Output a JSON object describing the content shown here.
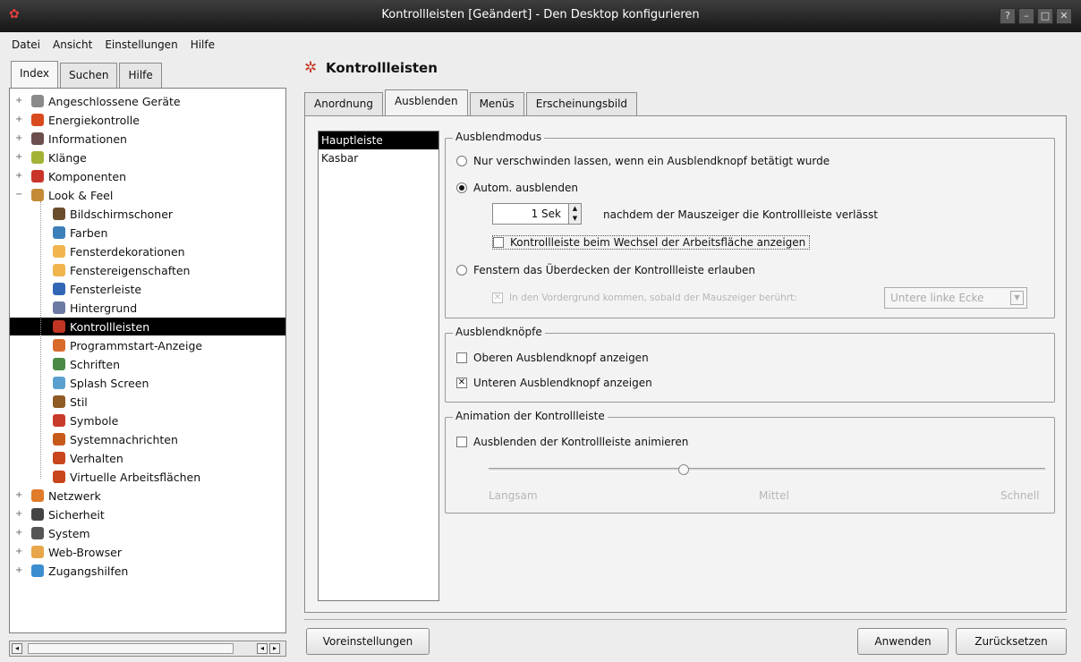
{
  "window": {
    "title": "Kontrollleisten [Geändert] - Den Desktop konfigurieren",
    "controls": [
      "?",
      "–",
      "□",
      "✕"
    ]
  },
  "menubar": [
    "Datei",
    "Ansicht",
    "Einstellungen",
    "Hilfe"
  ],
  "left_tabs": [
    "Index",
    "Suchen",
    "Hilfe"
  ],
  "tree": [
    {
      "label": "Angeschlossene Geräte",
      "icon": "devices-icon",
      "color": "#8a8a8a",
      "level": 0,
      "exp": "+"
    },
    {
      "label": "Energiekontrolle",
      "icon": "energy-icon",
      "color": "#d84b1e",
      "level": 0,
      "exp": "+"
    },
    {
      "label": "Informationen",
      "icon": "info-icon",
      "color": "#6c4e4e",
      "level": 0,
      "exp": "+"
    },
    {
      "label": "Klänge",
      "icon": "sound-icon",
      "color": "#a4b235",
      "level": 0,
      "exp": "+"
    },
    {
      "label": "Komponenten",
      "icon": "components-icon",
      "color": "#c93428",
      "level": 0,
      "exp": "+"
    },
    {
      "label": "Look & Feel",
      "icon": "look-feel-icon",
      "color": "#c58a36",
      "level": 0,
      "exp": "−"
    },
    {
      "label": "Bildschirmschoner",
      "icon": "screensaver-icon",
      "color": "#6a4d2c",
      "level": 1
    },
    {
      "label": "Farben",
      "icon": "colors-icon",
      "color": "#3d7fb8",
      "level": 1
    },
    {
      "label": "Fensterdekorationen",
      "icon": "window-deco-icon",
      "color": "#f0b54d",
      "level": 1
    },
    {
      "label": "Fenstereigenschaften",
      "icon": "window-props-icon",
      "color": "#f0b54d",
      "level": 1
    },
    {
      "label": "Fensterleiste",
      "icon": "taskbar-icon",
      "color": "#3166b5",
      "level": 1
    },
    {
      "label": "Hintergrund",
      "icon": "background-icon",
      "color": "#6b7aa3",
      "level": 1
    },
    {
      "label": "Kontrollleisten",
      "icon": "panels-icon",
      "color": "#c23524",
      "level": 1,
      "selected": true
    },
    {
      "label": "Programmstart-Anzeige",
      "icon": "launch-feedback-icon",
      "color": "#d86b2a",
      "level": 1
    },
    {
      "label": "Schriften",
      "icon": "fonts-icon",
      "color": "#4a8a46",
      "level": 1
    },
    {
      "label": "Splash Screen",
      "icon": "splash-icon",
      "color": "#5aa0cf",
      "level": 1
    },
    {
      "label": "Stil",
      "icon": "style-icon",
      "color": "#8f5a24",
      "level": 1
    },
    {
      "label": "Symbole",
      "icon": "symbols-icon",
      "color": "#c83a2a",
      "level": 1
    },
    {
      "label": "Systemnachrichten",
      "icon": "notifications-icon",
      "color": "#c65a1b",
      "level": 1
    },
    {
      "label": "Verhalten",
      "icon": "behavior-icon",
      "color": "#c9451d",
      "level": 1
    },
    {
      "label": "Virtuelle Arbeitsflächen",
      "icon": "desktops-icon",
      "color": "#c9451d",
      "level": 1
    },
    {
      "label": "Netzwerk",
      "icon": "network-icon",
      "color": "#e07b2a",
      "level": 0,
      "exp": "+"
    },
    {
      "label": "Sicherheit",
      "icon": "security-icon",
      "color": "#444444",
      "level": 0,
      "exp": "+"
    },
    {
      "label": "System",
      "icon": "system-icon",
      "color": "#555555",
      "level": 0,
      "exp": "+"
    },
    {
      "label": "Web-Browser",
      "icon": "web-browser-icon",
      "color": "#e8a64a",
      "level": 0,
      "exp": "+"
    },
    {
      "label": "Zugangshilfen",
      "icon": "accessibility-icon",
      "color": "#3b8ed0",
      "level": 0,
      "exp": "+"
    }
  ],
  "page_title": "Kontrollleisten",
  "tabs": [
    "Anordnung",
    "Ausblenden",
    "Menüs",
    "Erscheinungsbild"
  ],
  "panels_list": [
    "Hauptleiste",
    "Kasbar"
  ],
  "hide_mode": {
    "title": "Ausblendmodus",
    "opt1": "Nur verschwinden lassen, wenn ein Ausblendknopf betätigt wurde",
    "opt2": "Autom. ausblenden",
    "delay_value": "1 Sek",
    "delay_text": "nachdem der Mauszeiger die Kontrollleiste verlässt",
    "show_on_switch": "Kontrollleiste beim Wechsel der Arbeitsfläche anzeigen",
    "opt3": "Fenstern das Überdecken der Kontrollleiste erlauben",
    "raise_text": "In den Vordergrund kommen, sobald der Mauszeiger berührt:",
    "corner": "Untere linke Ecke"
  },
  "hide_buttons": {
    "title": "Ausblendknöpfe",
    "top": "Oberen Ausblendknopf anzeigen",
    "bottom": "Unteren Ausblendknopf anzeigen"
  },
  "animation": {
    "title": "Animation der Kontrollleiste",
    "animate": "Ausblenden der Kontrollleiste animieren",
    "slow": "Langsam",
    "medium": "Mittel",
    "fast": "Schnell",
    "speed_level": 0.35
  },
  "buttons": {
    "defaults": "Voreinstellungen",
    "apply": "Anwenden",
    "reset": "Zurücksetzen"
  }
}
